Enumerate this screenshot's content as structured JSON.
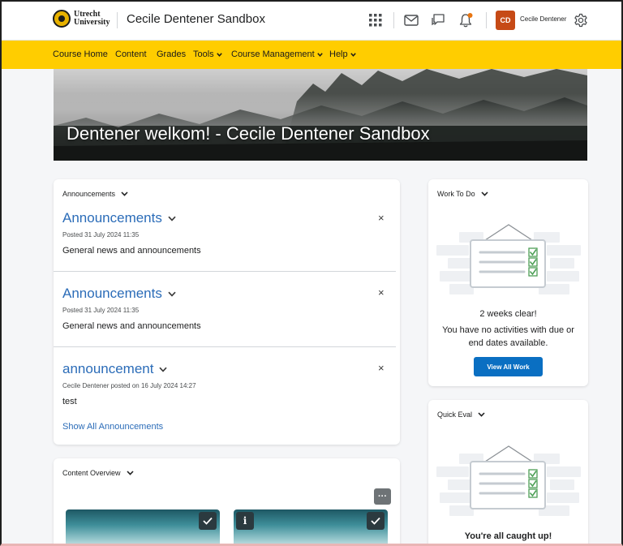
{
  "header": {
    "logo_line1": "Utrecht",
    "logo_line2": "University",
    "course_title": "Cecile Dentener Sandbox",
    "avatar_initials": "CD",
    "user_name": "Cecile Dentener",
    "icons": [
      "app-grid-icon",
      "mail-icon",
      "chat-icon",
      "bell-icon",
      "gear-icon"
    ],
    "notification_color": "#e87511"
  },
  "nav": {
    "items": [
      {
        "label": "Course Home",
        "dropdown": false
      },
      {
        "label": "Content",
        "dropdown": false
      },
      {
        "label": "Grades",
        "dropdown": false
      },
      {
        "label": "Tools",
        "dropdown": true
      },
      {
        "label": "Course Management",
        "dropdown": true
      },
      {
        "label": "Help",
        "dropdown": true
      }
    ],
    "bar_color": "#ffcd00"
  },
  "hero": {
    "title": "Dentener welkom! - Cecile Dentener Sandbox"
  },
  "announcements_widget": {
    "heading": "Announcements",
    "items": [
      {
        "title": "Announcements",
        "meta": "Posted 31 July 2024 11:35",
        "body": "General news and announcements"
      },
      {
        "title": "Announcements",
        "meta": "Posted 31 July 2024 11:35",
        "body": "General news and announcements"
      },
      {
        "title": "announcement",
        "meta": "Cecile Dentener posted on 16 July 2024 14:27",
        "body": "test"
      }
    ],
    "show_all_label": "Show All Announcements",
    "close_glyph": "×"
  },
  "work_to_do": {
    "heading": "Work To Do",
    "line1": "2 weeks clear!",
    "line2": "You have no activities with due or",
    "line3": "end dates available.",
    "button_label": "View All Work"
  },
  "quick_eval": {
    "heading": "Quick Eval",
    "message": "You're all caught up!"
  },
  "content_overview": {
    "heading": "Content Overview",
    "more_glyph": "···",
    "info_glyph": "i"
  },
  "colors": {
    "link": "#2b6cb8",
    "primary_button": "#0a6fc2",
    "avatar": "#c64a16"
  }
}
